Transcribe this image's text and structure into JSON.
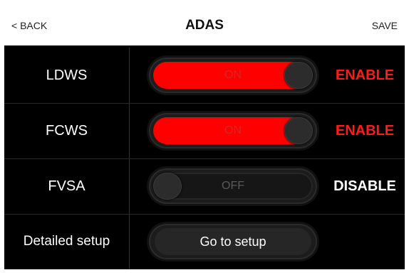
{
  "header": {
    "back_label": "< BACK",
    "title": "ADAS",
    "save_label": "SAVE"
  },
  "rows": [
    {
      "label": "LDWS",
      "toggle_text": "ON",
      "state": "on",
      "status": "ENABLE",
      "status_color": "#ff1a1a"
    },
    {
      "label": "FCWS",
      "toggle_text": "ON",
      "state": "on",
      "status": "ENABLE",
      "status_color": "#ff1a1a"
    },
    {
      "label": "FVSA",
      "toggle_text": "OFF",
      "state": "off",
      "status": "DISABLE",
      "status_color": "#ffffff"
    }
  ],
  "setup": {
    "label": "Detailed setup",
    "button_label": "Go to setup"
  },
  "colors": {
    "accent": "#ff0000",
    "background": "#000000"
  }
}
